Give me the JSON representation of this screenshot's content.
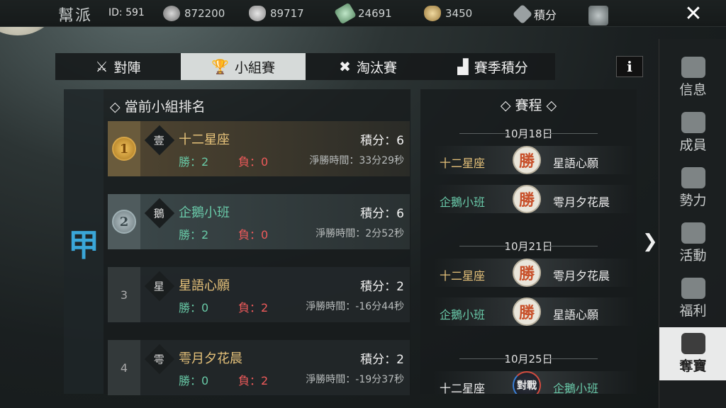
{
  "header": {
    "guild_label": "幫派",
    "guild_id": "ID: 591",
    "resources": [
      {
        "icon": "coin-stack-icon",
        "value": "872200"
      },
      {
        "icon": "silver-ingot-icon",
        "value": "89717"
      },
      {
        "icon": "jade-icon",
        "value": "24691"
      },
      {
        "icon": "gold-ingot-icon",
        "value": "3450"
      }
    ],
    "points_label": "積分",
    "close_icon": "✕"
  },
  "tabs": [
    {
      "label": "對陣",
      "icon": "sword-icon",
      "active": false
    },
    {
      "label": "小組賽",
      "icon": "trophy-icon",
      "active": true
    },
    {
      "label": "淘汰賽",
      "icon": "crossed-swords-icon",
      "active": false
    },
    {
      "label": "賽季積分",
      "icon": "podium-icon",
      "active": false
    }
  ],
  "info_label": "i",
  "group": {
    "char": "甲",
    "title": "當前小組排名"
  },
  "rankings": [
    {
      "rank": "1",
      "tag": "壹",
      "name": "十二星座",
      "points": "積分：6",
      "wins": "勝：2",
      "losses": "負：0",
      "net": "淨勝時間：33分29秒"
    },
    {
      "rank": "2",
      "tag": "鵝",
      "name": "企鵝小班",
      "points": "積分：6",
      "wins": "勝：2",
      "losses": "負：0",
      "net": "淨勝時間：2分52秒"
    },
    {
      "rank": "3",
      "tag": "星",
      "name": "星語心願",
      "points": "積分：2",
      "wins": "勝：0",
      "losses": "負：2",
      "net": "淨勝時間：-16分44秒"
    },
    {
      "rank": "4",
      "tag": "雩",
      "name": "雩月夕花晨",
      "points": "積分：2",
      "wins": "勝：0",
      "losses": "負：2",
      "net": "淨勝時間：-19分37秒"
    }
  ],
  "schedule": {
    "title": "賽程",
    "dates": [
      "10月18日",
      "10月21日",
      "10月25日"
    ],
    "matches": [
      {
        "a": "十二星座",
        "result": "勝",
        "b": "星語心願"
      },
      {
        "a": "企鵝小班",
        "result": "勝",
        "b": "雩月夕花晨"
      },
      {
        "a": "十二星座",
        "result": "勝",
        "b": "雩月夕花晨"
      },
      {
        "a": "企鵝小班",
        "result": "勝",
        "b": "星語心願"
      },
      {
        "a": "十二星座",
        "result": "對戰",
        "b": "企鵝小班"
      }
    ]
  },
  "sidebar": [
    {
      "label": "信息",
      "icon": "info-scroll-icon"
    },
    {
      "label": "成員",
      "icon": "members-icon"
    },
    {
      "label": "勢力",
      "icon": "banner-icon"
    },
    {
      "label": "活動",
      "icon": "activity-icon"
    },
    {
      "label": "福利",
      "icon": "gift-bag-icon"
    },
    {
      "label": "奪寶",
      "icon": "treasure-icon",
      "active": true
    }
  ],
  "colors": {
    "gold_name": "#e6c27a",
    "teal_name": "#69c8a8",
    "win": "#68c9a6",
    "loss": "#ee5a5a",
    "group_char": "#3aa6d8"
  }
}
